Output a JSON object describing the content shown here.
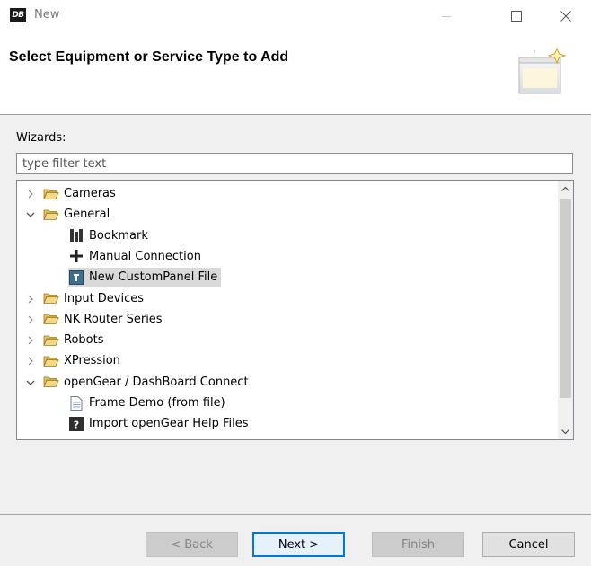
{
  "window": {
    "logo_text": "DB",
    "title": "New"
  },
  "header": {
    "title": "Select Equipment or Service Type to Add"
  },
  "wizards": {
    "label": "Wizards:",
    "filter_placeholder": "type filter text"
  },
  "tree": [
    {
      "label": "Cameras",
      "expanded": false,
      "type": "folder",
      "level": 0
    },
    {
      "label": "General",
      "expanded": true,
      "type": "folder",
      "level": 0
    },
    {
      "label": "Bookmark",
      "type": "bookmark-icon",
      "level": 1
    },
    {
      "label": "Manual Connection",
      "type": "plus-icon",
      "level": 1
    },
    {
      "label": "New CustomPanel File",
      "type": "custompanel-icon",
      "level": 1,
      "selected": true
    },
    {
      "label": "Input Devices",
      "expanded": false,
      "type": "folder",
      "level": 0
    },
    {
      "label": "NK Router Series",
      "expanded": false,
      "type": "folder",
      "level": 0
    },
    {
      "label": "Robots",
      "expanded": false,
      "type": "folder",
      "level": 0
    },
    {
      "label": "XPression",
      "expanded": false,
      "type": "folder",
      "level": 0
    },
    {
      "label": "openGear / DashBoard Connect",
      "expanded": true,
      "type": "folder",
      "level": 0
    },
    {
      "label": "Frame Demo (from file)",
      "type": "file-icon",
      "level": 1
    },
    {
      "label": "Import openGear Help Files",
      "type": "help-icon",
      "level": 1
    }
  ],
  "buttons": {
    "back": "< Back",
    "next": "Next >",
    "finish": "Finish",
    "cancel": "Cancel"
  },
  "colors": {
    "folder": "#e8c25a",
    "selection": "#d9d9d9",
    "accent": "#0078d7"
  }
}
